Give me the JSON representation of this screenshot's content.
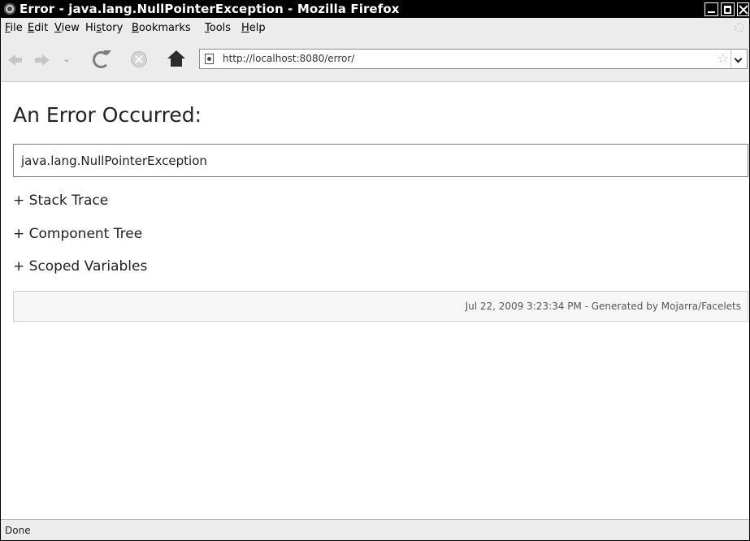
{
  "window": {
    "title": "Error - java.lang.NullPointerException - Mozilla Firefox"
  },
  "menu": {
    "items": [
      {
        "underline": "F",
        "rest": "ile"
      },
      {
        "underline": "E",
        "rest": "dit"
      },
      {
        "underline": "V",
        "rest": "iew"
      },
      {
        "pre": "Hi",
        "underline": "s",
        "rest": "tory"
      },
      {
        "underline": "B",
        "rest": "ookmarks"
      },
      {
        "underline": "T",
        "rest": "ools"
      },
      {
        "underline": "H",
        "rest": "elp"
      }
    ]
  },
  "navbar": {
    "url": "http://localhost:8080/error/",
    "icons": [
      "back-icon",
      "forward-icon",
      "history-dropdown-icon",
      "reload-icon",
      "stop-icon",
      "home-icon",
      "site-identity-icon",
      "bookmark-star-icon",
      "url-dropdown-icon"
    ]
  },
  "page": {
    "heading": "An Error Occurred:",
    "exception": "java.lang.NullPointerException",
    "sections": [
      "+ Stack Trace",
      "+ Component Tree",
      "+ Scoped Variables"
    ],
    "footer": "Jul 22, 2009 3:23:34 PM - Generated by Mojarra/Facelets"
  },
  "status": {
    "text": "Done"
  }
}
